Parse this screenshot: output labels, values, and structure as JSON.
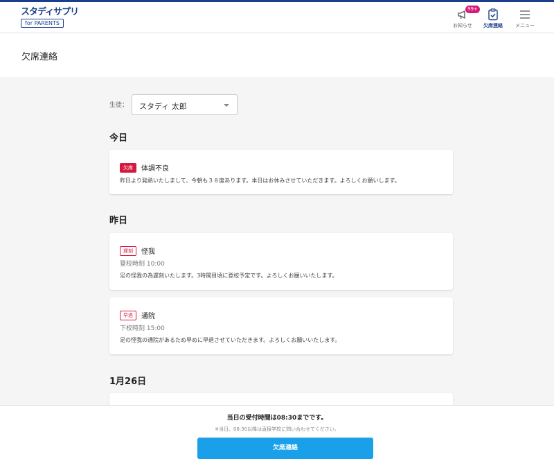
{
  "header": {
    "logo_main": "スタディサプリ",
    "logo_sub": "for PARENTS",
    "nav": {
      "notice_label": "お知らせ",
      "notice_badge": "99+",
      "absence_label": "欠席連絡",
      "menu_label": "メニュー"
    },
    "accent_color": "#1a3e8c"
  },
  "page_title": "欠席連絡",
  "student": {
    "label": "生徒：",
    "selected": "スタディ 太郎"
  },
  "days": {
    "today": "今日",
    "yesterday": "昨日",
    "jan26": "1月26日"
  },
  "entries": [
    {
      "tag": "欠席",
      "reason": "体調不良",
      "message": "昨日より発熱いたしまして、今朝も３８度あります。本日はお休みさせていただきます。よろしくお願いします。"
    },
    {
      "tag": "遅刻",
      "reason": "怪我",
      "time": "登校時刻 10:00",
      "message": "足の怪我の為遅刻いたします。3時間目頃に登校予定です。よろしくお願いいたします。"
    },
    {
      "tag": "早退",
      "reason": "通院",
      "time": "下校時刻 15:00",
      "message": "足の怪我の通院があるため早めに早退させていただきます。よろしくお願いいたします。"
    }
  ],
  "footer": {
    "main_text": "当日の受付時間は08:30までです。",
    "note": "※当日、08:30以降は直接学校に問い合わせてください。",
    "button_label": "欠席連絡",
    "button_color": "#1aa0e8"
  },
  "tag_color": "#d6193f"
}
